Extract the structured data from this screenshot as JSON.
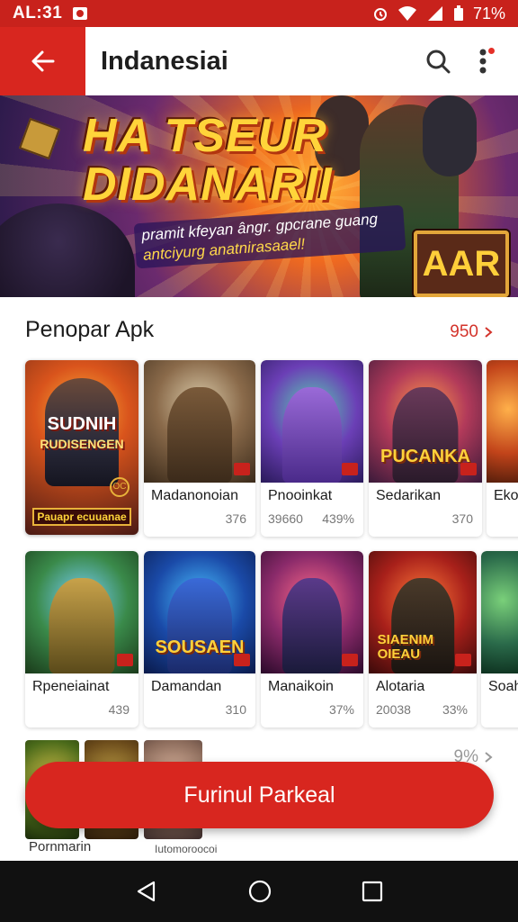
{
  "status_bar": {
    "time": "AL:31",
    "battery": "71%"
  },
  "app_bar": {
    "title": "Indanesiai",
    "back_icon": "arrow-left-icon",
    "search_icon": "search-icon",
    "more_icon": "more-vertical-icon"
  },
  "banner": {
    "title_line1": "HA TSEUR",
    "title_line2": "DIDANARII",
    "subtitle_line1": "pramit kfeyan ângr. gpcrane guang",
    "subtitle_line2": "antciyurg anatnirasaael!",
    "badge": "AAR"
  },
  "section": {
    "title": "Penopar Apk",
    "more": "950"
  },
  "featured": {
    "title_line1": "SUDNIH",
    "title_line2": "RUDISENGEN",
    "plate": "Pauapr ecuuanae",
    "badge": "OC"
  },
  "row1": [
    {
      "name": "Madanonoian",
      "meta": "376"
    },
    {
      "name": "Pnooinkat",
      "meta_left": "39660",
      "meta": "439%"
    },
    {
      "name": "Sedarikan",
      "meta": "370"
    },
    {
      "name": "Ekon"
    }
  ],
  "row2": [
    {
      "name": "Rpeneiainat",
      "meta": "439"
    },
    {
      "name": "Damandan",
      "meta": "310"
    },
    {
      "name": "Manaikoin",
      "meta": "37%"
    },
    {
      "name": "Alotaria",
      "meta_left": "20038",
      "meta": "33%"
    },
    {
      "name": "Soah"
    }
  ],
  "art_labels": {
    "card_r1_3": "PUCANKA",
    "card_r2_1": "SOUSAEN",
    "card_r2_3": "SIAENIM OIEAU"
  },
  "bottom": {
    "label_left": "Pornmarin",
    "label_right": "Iutomoroocoi",
    "more": "9%"
  },
  "cta": {
    "label": "Furinul Parkeal"
  },
  "colors": {
    "primary": "#d8261f",
    "status": "#c8221c",
    "nav": "#111111"
  }
}
